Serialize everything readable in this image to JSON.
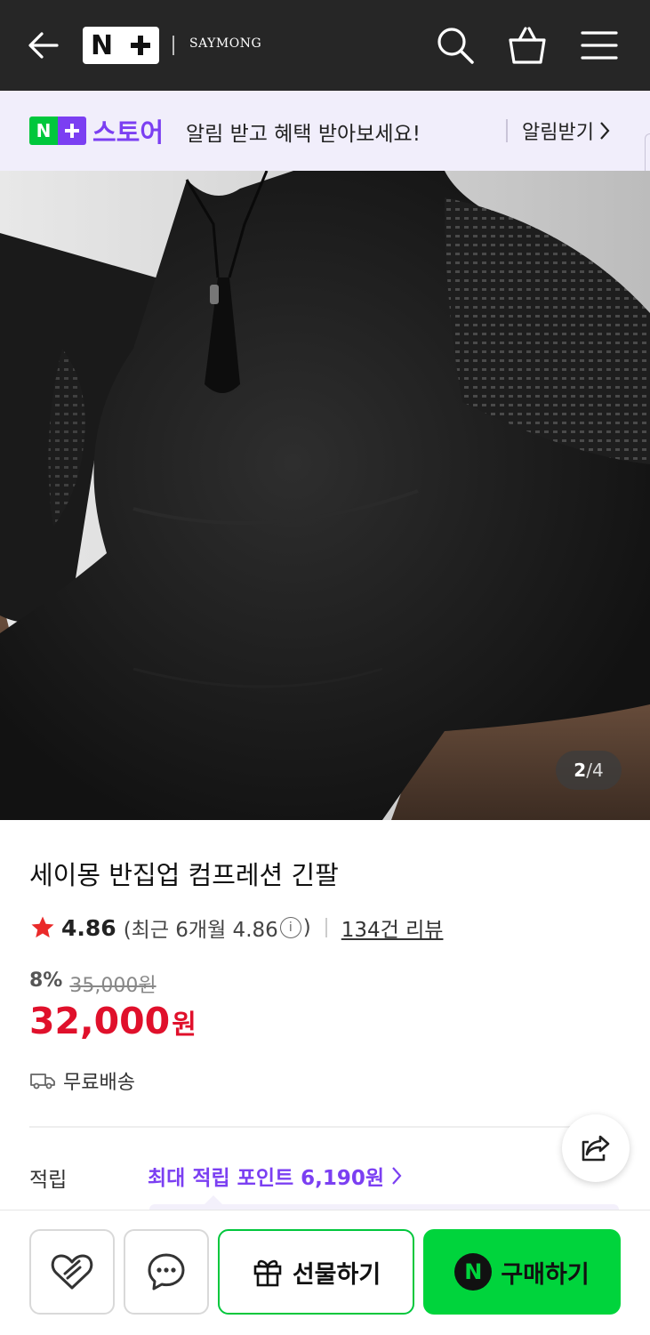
{
  "header": {
    "logo_n": "N",
    "store_name": "SAYMONG",
    "icons": [
      "back-arrow-icon",
      "plus-icon",
      "search-icon",
      "shopping-bag-icon",
      "hamburger-menu-icon"
    ]
  },
  "notice": {
    "badge_n": "N",
    "store_word": "스토어",
    "message": "알림 받고 혜택 받아보세요!",
    "action_label": "알림받기"
  },
  "gallery": {
    "current": "2",
    "separator": "/",
    "total": "4"
  },
  "product": {
    "title": "세이몽 반집업 컴프레션 긴팔",
    "rating": "4.86",
    "recent_prefix": "(최근 6개월 4.86",
    "recent_suffix": ")",
    "info_glyph": "i",
    "review_count_label": "134건 리뷰",
    "discount_pct": "8%",
    "original_price": "35,000원",
    "sale_price": "32,000",
    "currency": "원",
    "shipping": "무료배송"
  },
  "points": {
    "label": "적립",
    "link_text": "최대 적립 포인트 6,190원"
  },
  "actions": {
    "gift_label": "선물하기",
    "buy_n": "N",
    "buy_label": "구매하기"
  },
  "colors": {
    "header_bg": "#262626",
    "naver_green": "#00c73c",
    "store_purple": "#7b3ff2",
    "price_red": "#e0102b",
    "notice_bg": "#f1eefb"
  }
}
